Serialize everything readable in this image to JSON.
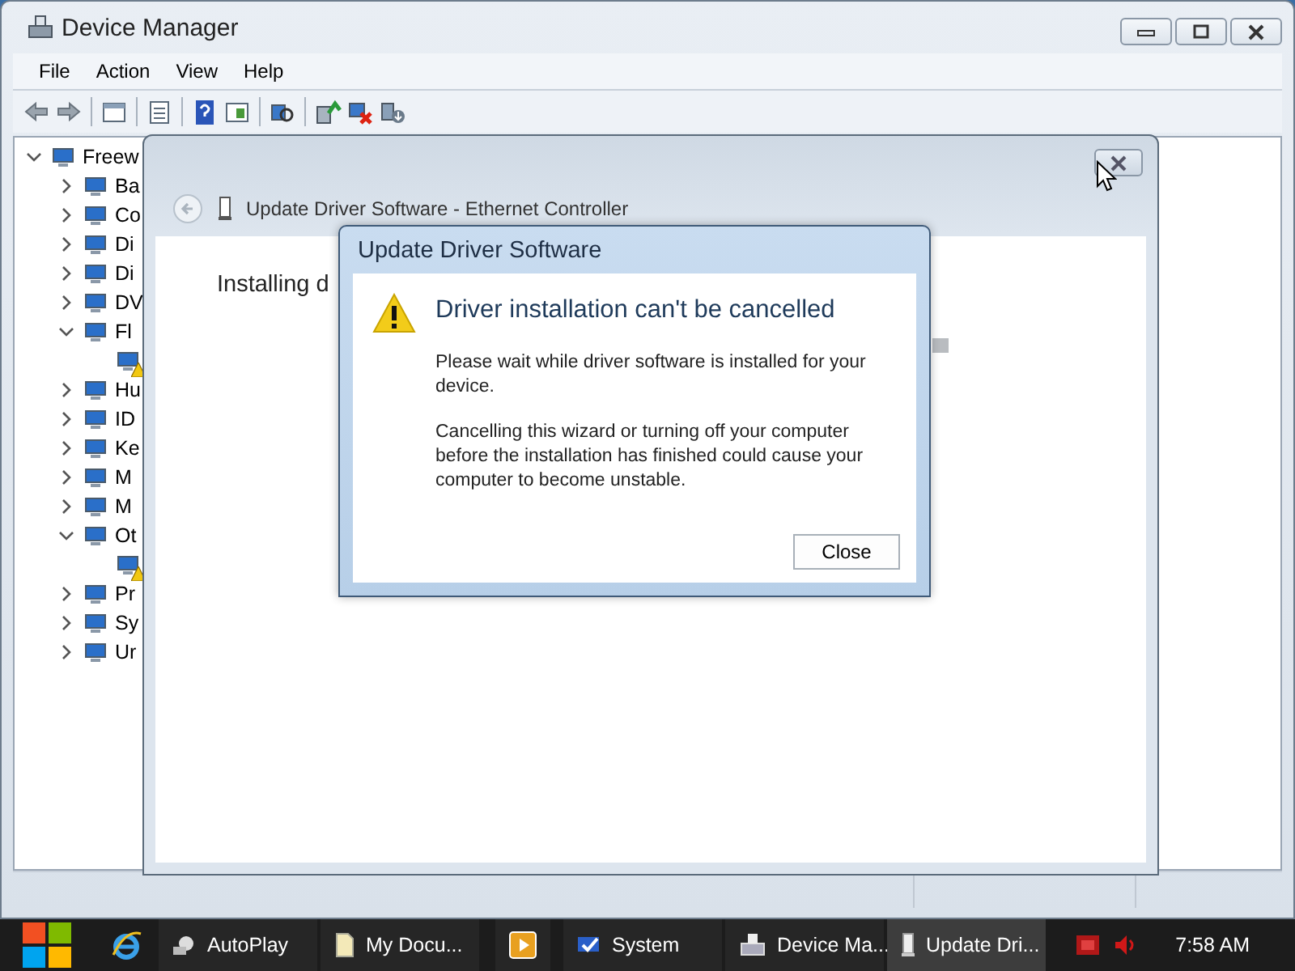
{
  "device_manager": {
    "title": "Device Manager",
    "menu": [
      "File",
      "Action",
      "View",
      "Help"
    ],
    "tree": [
      {
        "label": "Freew",
        "expanded": true,
        "children": [
          {
            "label": "Ba",
            "expanded": false
          },
          {
            "label": "Co",
            "expanded": false
          },
          {
            "label": "Di",
            "expanded": false
          },
          {
            "label": "Di",
            "expanded": false
          },
          {
            "label": "DV",
            "expanded": false
          },
          {
            "label": "Fl",
            "expanded": true,
            "children": [
              {
                "warning": true
              }
            ]
          },
          {
            "label": "Hu",
            "expanded": false
          },
          {
            "label": "ID",
            "expanded": false
          },
          {
            "label": "Ke",
            "expanded": false
          },
          {
            "label": "M",
            "expanded": false
          },
          {
            "label": "M",
            "expanded": false
          },
          {
            "label": "Ot",
            "expanded": true,
            "children": [
              {
                "warning": true
              }
            ]
          },
          {
            "label": "Pr",
            "expanded": false
          },
          {
            "label": "Sy",
            "expanded": false
          },
          {
            "label": "Ur",
            "expanded": false
          }
        ]
      }
    ]
  },
  "wizard": {
    "title": "Update Driver Software - Ethernet Controller",
    "status": "Installing d"
  },
  "dialog": {
    "title": "Update Driver Software",
    "heading": "Driver installation can't be cancelled",
    "paragraphs": [
      "Please wait while driver software is installed for your device.",
      "Cancelling this wizard or turning off your computer before the installation has finished could cause your computer to become unstable."
    ],
    "button": "Close"
  },
  "taskbar": {
    "items": [
      {
        "label": "AutoPlay",
        "selected": false
      },
      {
        "label": "My Docu...",
        "selected": false
      },
      {
        "selected": false
      },
      {
        "label": "System",
        "selected": false
      },
      {
        "label": "Device Ma...",
        "selected": false
      },
      {
        "label": "Update Dri...",
        "selected": true
      }
    ],
    "clock": "7:58 AM"
  }
}
